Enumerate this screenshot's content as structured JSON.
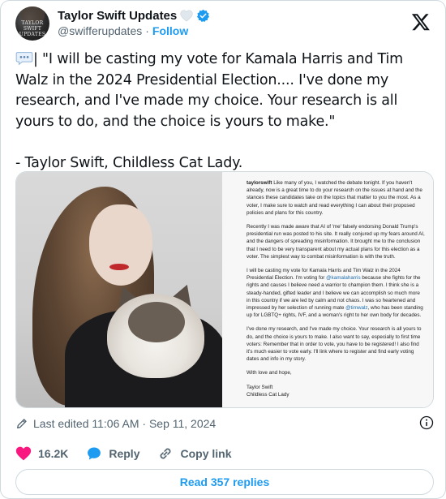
{
  "header": {
    "display_name": "Taylor Swift Updates",
    "handle": "@swifferupdates",
    "separator": "·",
    "follow_label": "Follow",
    "avatar_text": "TAYLOR SWIFT UPDATES"
  },
  "tweet": {
    "text": "| \"I will be casting my vote for Kamala Harris and Tim Walz in the 2024 Presidential Election.... I've done my research, and I've made my choice. Your research is all yours to do, and the choice is yours to make.\"\n\n- Taylor Swift, Childless Cat Lady."
  },
  "statement": {
    "p1_handle": "taylorswift",
    "p1": " Like many of you, I watched the debate tonight. If you haven't already, now is a great time to do your research on the issues at hand and the stances these candidates take on the topics that matter to you the most. As a voter, I make sure to watch and read everything I can about their proposed policies and plans for this country.",
    "p2": "Recently I was made aware that AI of 'me' falsely endorsing Donald Trump's presidential run was posted to his site. It really conjured up my fears around AI, and the dangers of spreading misinformation. It brought me to the conclusion that I need to be very transparent about my actual plans for this election as a voter. The simplest way to combat misinformation is with the truth.",
    "p3a": "I will be casting my vote for Kamala Harris and Tim Walz in the 2024 Presidential Election. I'm voting for ",
    "p3_mention1": "@kamalaharris",
    "p3b": " because she fights for the rights and causes I believe need a warrior to champion them. I think she is a steady-handed, gifted leader and I believe we can accomplish so much more in this country if we are led by calm and not chaos. I was so heartened and impressed by her selection of running mate ",
    "p3_mention2": "@timwalz",
    "p3c": ", who has been standing up for LGBTQ+ rights, IVF, and a woman's right to her own body for decades.",
    "p4": "I've done my research, and I've made my choice. Your research is all yours to do, and the choice is yours to make. I also want to say, especially to first time voters: Remember that in order to vote, you have to be registered! I also find it's much easier to vote early. I'll link where to register and find early voting dates and info in my story.",
    "p5": "With love and hope,",
    "sign1": "Taylor Swift",
    "sign2": "Childless Cat Lady"
  },
  "meta": {
    "edited": "Last edited 11:06 AM · Sep 11, 2024"
  },
  "actions": {
    "likes": "16.2K",
    "reply_label": "Reply",
    "copy_link_label": "Copy link"
  },
  "footer": {
    "read_replies_label": "Read 357 replies"
  },
  "colors": {
    "accent": "#1d9bf0",
    "like": "#f91880",
    "secondary_text": "#536471",
    "border": "#cfd9de"
  },
  "icons": [
    "white-heart-icon",
    "verified-badge-icon",
    "x-logo-icon",
    "speech-balloon-icon",
    "pencil-icon",
    "info-icon",
    "heart-icon",
    "reply-icon",
    "link-icon"
  ]
}
